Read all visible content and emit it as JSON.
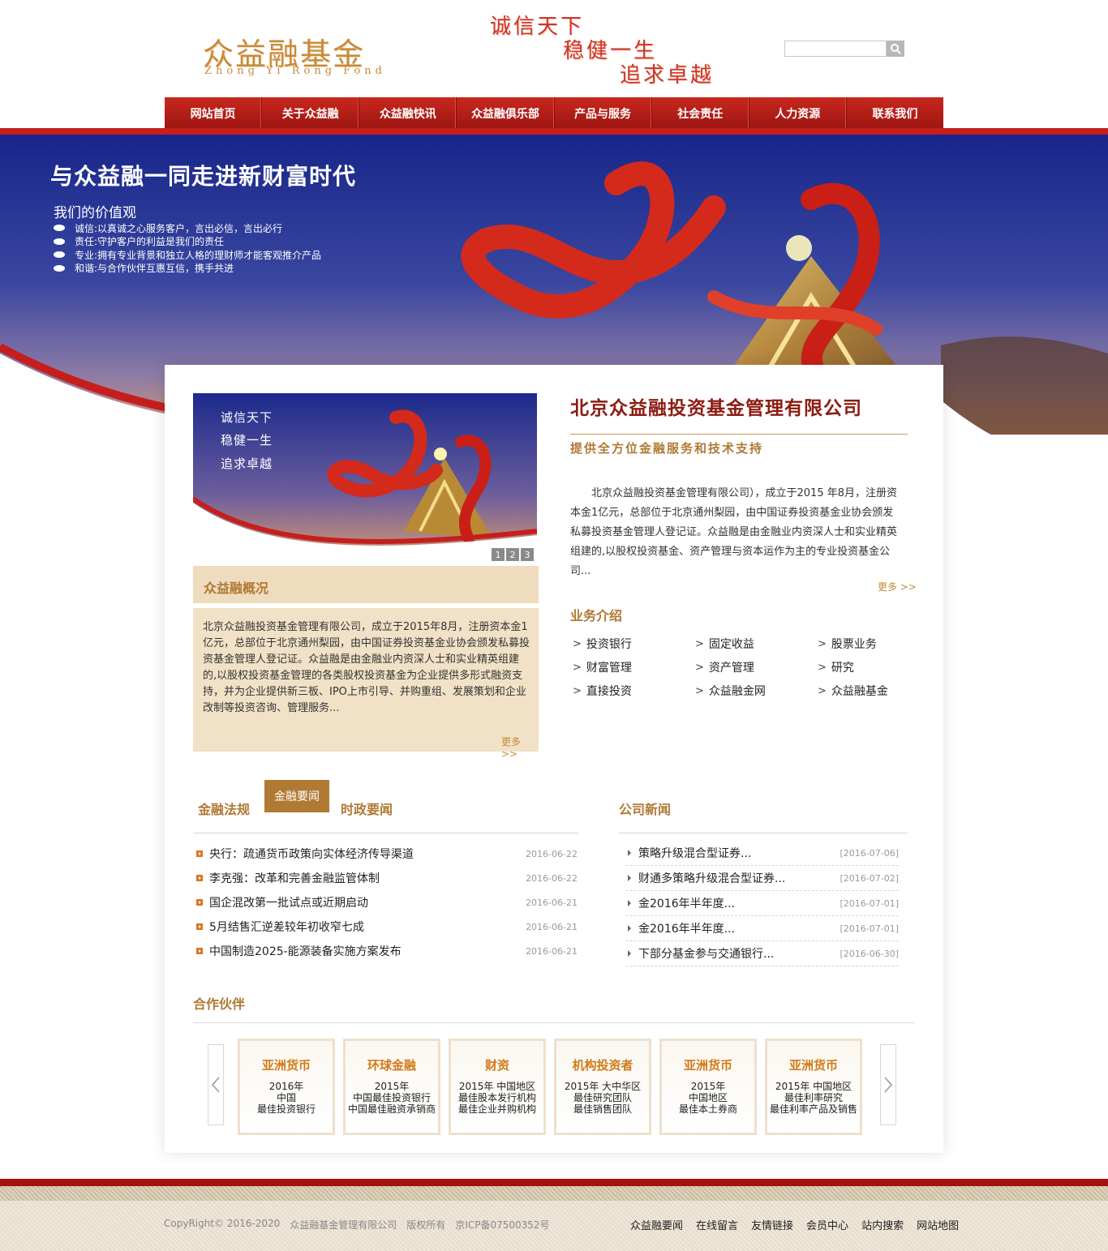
{
  "header": {
    "logo_cn": "众益融基金",
    "logo_en": "Zhong Yi Rong Fond",
    "slogans": [
      "诚信天下",
      "稳健一生",
      "追求卓越"
    ],
    "search_placeholder": ""
  },
  "nav": [
    "网站首页",
    "关于众益融",
    "众益融快讯",
    "众益融俱乐部",
    "产品与服务",
    "社会责任",
    "人力资源",
    "联系我们"
  ],
  "banner": {
    "title": "与众益融一同走进新财富时代",
    "subtitle": "我们的价值观",
    "values": [
      "诚信:以真诚之心服务客户，言出必信，言出必行",
      "责任:守护客户的利益是我们的责任",
      "专业:拥有专业背景和独立人格的理财师才能客观推介产品",
      "和谐:与合作伙伴互惠互信，携手共进"
    ]
  },
  "mini_banner": {
    "lines": [
      "诚信天下",
      "稳健一生",
      "追求卓越"
    ],
    "pages": [
      "1",
      "2",
      "3"
    ]
  },
  "overview": {
    "title": "众益融概况",
    "text": "北京众益融投资基金管理有限公司，成立于2015年8月，注册资本金1亿元，总部位于北京通州梨园，由中国证券投资基金业协会颁发私募投资基金管理人登记证。众益融是由金融业内资深人士和实业精英组建的,以股权投资基金管理的各类股权投资基金为企业提供多形式融资支持，并为企业提供新三板、IPO上市引导、并购重组、发展策划和企业改制等投资咨询、管理服务...",
    "more": "更多 >>"
  },
  "company": {
    "title": "北京众益融投资基金管理有限公司",
    "subtitle": "提供全方位金融服务和技术支持",
    "intro": "北京众益融投资基金管理有限公司），成立于2015 年8月，注册资本金1亿元，总部位于北京通州梨园，由中国证券投资基金业协会颁发私募投资基金管理人登记证。众益融是由金融业内资深人士和实业精英组建的,以股权投资基金、资产管理与资本运作为主的专业投资基金公司...",
    "more": "更多 >>"
  },
  "business": {
    "title": "业务介绍",
    "items": [
      "投资银行",
      "固定收益",
      "股票业务",
      "财富管理",
      "资产管理",
      "研究",
      "直接投资",
      "众益融金网",
      "众益融基金"
    ]
  },
  "news_tabs": [
    "金融法规",
    "金融要闻",
    "时政要闻"
  ],
  "news": [
    {
      "title": "央行：疏通货币政策向实体经济传导渠道",
      "date": "2016-06-22"
    },
    {
      "title": "李克强：改革和完善金融监管体制",
      "date": "2016-06-22"
    },
    {
      "title": "国企混改第一批试点或近期启动",
      "date": "2016-06-21"
    },
    {
      "title": "5月结售汇逆差较年初收窄七成",
      "date": "2016-06-21"
    },
    {
      "title": "中国制造2025-能源装备实施方案发布",
      "date": "2016-06-21"
    }
  ],
  "company_news": {
    "title": "公司新闻",
    "items": [
      {
        "title": "策略升级混合型证券...",
        "date": "[2016-07-06]"
      },
      {
        "title": "财通多策略升级混合型证券...",
        "date": "[2016-07-02]"
      },
      {
        "title": "金2016年半年度...",
        "date": "[2016-07-01]"
      },
      {
        "title": "金2016年半年度...",
        "date": "[2016-07-01]"
      },
      {
        "title": "下部分基金参与交通银行...",
        "date": "[2016-06-30]"
      }
    ]
  },
  "partners": {
    "title": "合作伙伴",
    "cards": [
      {
        "name": "亚洲货币",
        "lines": [
          "2016年",
          "中国",
          "最佳投资银行"
        ]
      },
      {
        "name": "环球金融",
        "lines": [
          "2015年",
          "中国最佳投资银行",
          "中国最佳融资承销商"
        ]
      },
      {
        "name": "财资",
        "lines": [
          "2015年  中国地区",
          "最佳股本发行机构",
          "最佳企业并购机构"
        ]
      },
      {
        "name": "机构投资者",
        "lines": [
          "2015年  大中华区",
          "最佳研究团队",
          "最佳销售团队"
        ]
      },
      {
        "name": "亚洲货币",
        "lines": [
          "2015年",
          "中国地区",
          "最佳本土券商"
        ]
      },
      {
        "name": "亚洲货币",
        "lines": [
          "2015年  中国地区",
          "最佳利率研究",
          "最佳利率产品及销售"
        ]
      }
    ]
  },
  "footer": {
    "copyright": "CopyRight© 2016-2020",
    "company": "众益融基金管理有限公司",
    "rights": "版权所有",
    "icp": "京ICP备07500352号",
    "links": [
      "众益融要闻",
      "在线留言",
      "友情链接",
      "会员中心",
      "站内搜索",
      "网站地图"
    ]
  },
  "colors": {
    "brand_red": "#c61e1c",
    "gold": "#b07934",
    "banner_blue": "#1d2f8c"
  }
}
